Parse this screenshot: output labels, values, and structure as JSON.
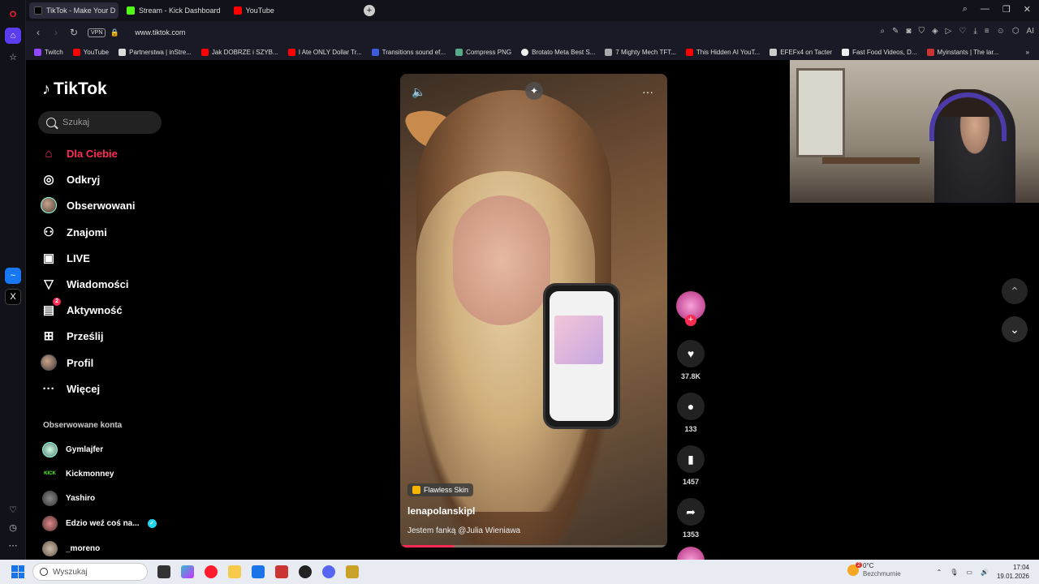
{
  "browser": {
    "tabs": [
      {
        "label": "TikTok - Make Your D",
        "active": true
      },
      {
        "label": "Stream - Kick Dashboard",
        "active": false
      },
      {
        "label": "YouTube",
        "active": false
      }
    ],
    "vpn_label": "VPN",
    "url": "www.tiktok.com",
    "bookmarks": [
      "Twitch",
      "YouTube",
      "Partnerstwa | inStre...",
      "Jak DOBRZE i SZYB...",
      "I Ate ONLY Dollar Tr...",
      "Transitions sound ef...",
      "Compress PNG",
      "Brotato Meta Best S...",
      "7 Mighty Mech TFT...",
      "This Hidden AI YouT...",
      "EFEFx4 on Tacter",
      "Fast Food Videos, D...",
      "Myinstants | The lar..."
    ]
  },
  "tiktok": {
    "logo": "TikTok",
    "search_placeholder": "Szukaj",
    "nav": [
      {
        "label": "Dla Ciebie",
        "icon": "home-icon",
        "active": true
      },
      {
        "label": "Odkryj",
        "icon": "compass-icon"
      },
      {
        "label": "Obserwowani",
        "icon": "avatar-icon"
      },
      {
        "label": "Znajomi",
        "icon": "friends-icon"
      },
      {
        "label": "LIVE",
        "icon": "live-tv-icon"
      },
      {
        "label": "Wiadomości",
        "icon": "send-icon"
      },
      {
        "label": "Aktywność",
        "icon": "inbox-icon",
        "badge": "2"
      },
      {
        "label": "Prześlij",
        "icon": "upload-plus-icon"
      },
      {
        "label": "Profil",
        "icon": "profile-avatar-icon"
      },
      {
        "label": "Więcej",
        "icon": "more-dots-icon"
      }
    ],
    "followed_title": "Obserwowane konta",
    "followed": [
      {
        "name": "Gymlajfer",
        "color": "#7aa"
      },
      {
        "name": "Kickmonney",
        "color": "#53fc18"
      },
      {
        "name": "Yashiro",
        "color": "#666"
      },
      {
        "name": "Edzio weź coś na...",
        "color": "#a55",
        "verified": true
      },
      {
        "name": "_moreno",
        "color": "#987"
      }
    ]
  },
  "video": {
    "effect_label": "Flawless Skin",
    "username": "lenapolanskipl",
    "caption": "Jestem fanką @Julia Wieniawa",
    "progress_percent": 20,
    "likes": "37.8K",
    "comments": "133",
    "saves": "1457",
    "shares": "1353"
  },
  "taskbar": {
    "search_placeholder": "Wyszukaj",
    "weather_temp": "0°C",
    "weather_desc": "Bezchmurnie",
    "weather_badge": "2",
    "time": "17:04",
    "date": "19.01.2026"
  }
}
